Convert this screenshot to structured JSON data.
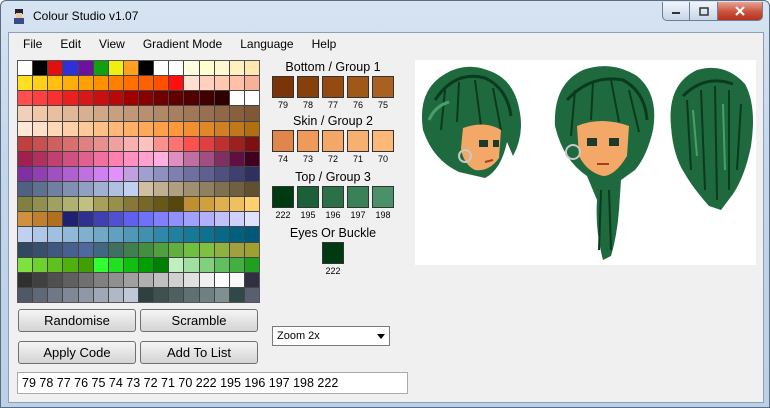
{
  "window": {
    "title": "Colour Studio v1.07"
  },
  "menu": [
    "File",
    "Edit",
    "View",
    "Gradient Mode",
    "Language",
    "Help"
  ],
  "palette": [
    [
      "#ffffff",
      "#000000",
      "#e01010",
      "#3030d8",
      "#7010a0",
      "#10a010",
      "#f0f010",
      "#ffa020",
      "#000000",
      "#ffffff",
      "#ffffff",
      "#ffffe0",
      "#ffffd0",
      "#fff8d0",
      "#fff0c0",
      "#ffe8b0"
    ],
    [
      "#ffe020",
      "#ffd018",
      "#ffc010",
      "#ffb008",
      "#ffa000",
      "#ff9000",
      "#ff8000",
      "#ff7000",
      "#ff6000",
      "#ff5000",
      "#ff1010",
      "#ffe0d0",
      "#ffd0c0",
      "#ffc8b0",
      "#ffc0a8",
      "#f8b098"
    ],
    [
      "#ff5050",
      "#ff4040",
      "#f83030",
      "#e82020",
      "#d81818",
      "#c81010",
      "#b80808",
      "#a00000",
      "#880000",
      "#700000",
      "#600000",
      "#500000",
      "#400000",
      "#300000",
      "#ffffff",
      "#ffffff"
    ],
    [
      "#f0d0b8",
      "#f0c8a8",
      "#e8c0a0",
      "#e0b898",
      "#d8b090",
      "#d0a888",
      "#c8a080",
      "#c09878",
      "#b89070",
      "#b08868",
      "#a88060",
      "#a07858",
      "#987050",
      "#906848",
      "#886040",
      "#805838"
    ],
    [
      "#ffe8d8",
      "#ffe0c8",
      "#ffd8b8",
      "#ffd0a8",
      "#ffc898",
      "#ffc088",
      "#ffb878",
      "#ffb068",
      "#ffa858",
      "#ffa048",
      "#ff9838",
      "#f09030",
      "#e08828",
      "#d08020",
      "#c07818",
      "#b07010"
    ],
    [
      "#c04040",
      "#c85050",
      "#d06060",
      "#d87070",
      "#e08080",
      "#e89090",
      "#f0a0a0",
      "#f8b0b0",
      "#ffc0c0",
      "#ff9090",
      "#ff7070",
      "#ff5050",
      "#e04040",
      "#c03030",
      "#a02020",
      "#801010"
    ],
    [
      "#a02050",
      "#b03060",
      "#c04070",
      "#d05080",
      "#e06090",
      "#f070a0",
      "#ff80b0",
      "#ff90c0",
      "#ffa0d0",
      "#ffb0e0",
      "#e090c0",
      "#c070a0",
      "#a05080",
      "#803060",
      "#601040",
      "#400020"
    ],
    [
      "#8030a0",
      "#9040b0",
      "#a050c0",
      "#b060d0",
      "#c070e0",
      "#d080f0",
      "#e090ff",
      "#c0a0e0",
      "#a0a0d0",
      "#9090c0",
      "#8080b0",
      "#7070a0",
      "#606090",
      "#505080",
      "#404070",
      "#303060"
    ],
    [
      "#506080",
      "#607090",
      "#7080a0",
      "#8090b0",
      "#90a0c0",
      "#a0b0d0",
      "#b0c0e0",
      "#c0d0f0",
      "#d0c0a0",
      "#c0b090",
      "#b0a080",
      "#a09070",
      "#908060",
      "#807050",
      "#706040",
      "#605030"
    ],
    [
      "#808040",
      "#909050",
      "#a0a060",
      "#b0b070",
      "#c0c080",
      "#a8a058",
      "#989048",
      "#887838",
      "#786828",
      "#685818",
      "#584808",
      "#c09030",
      "#d0a040",
      "#e0b050",
      "#f0c060",
      "#ffd070"
    ],
    [
      "#d09040",
      "#c08030",
      "#b07020",
      "#202070",
      "#303090",
      "#4040b0",
      "#5050d0",
      "#6060f0",
      "#7070ff",
      "#8080ff",
      "#9090ff",
      "#a0a0ff",
      "#b0b0ff",
      "#c0c0ff",
      "#d0d0ff",
      "#e0e0ff"
    ],
    [
      "#c0d0f0",
      "#b0c8e8",
      "#a0c0e0",
      "#90b8d8",
      "#80b0d0",
      "#70a8c8",
      "#60a0c0",
      "#5098b8",
      "#4090b0",
      "#3088a8",
      "#2080a0",
      "#187898",
      "#107090",
      "#086888",
      "#006080",
      "#005878"
    ],
    [
      "#304860",
      "#385070",
      "#405880",
      "#486090",
      "#5068a0",
      "#406880",
      "#407060",
      "#408050",
      "#409040",
      "#50a040",
      "#60b040",
      "#70c040",
      "#80c040",
      "#90b040",
      "#a0a040",
      "#a0a030"
    ],
    [
      "#80e040",
      "#70d030",
      "#60c020",
      "#50b010",
      "#40a000",
      "#30ff30",
      "#20e020",
      "#10c010",
      "#00a000",
      "#008000",
      "#c0f0c0",
      "#a0e0a0",
      "#80d080",
      "#60c060",
      "#40b040",
      "#20a020"
    ],
    [
      "#303030",
      "#404040",
      "#505050",
      "#606060",
      "#707070",
      "#808080",
      "#909090",
      "#a0a0a0",
      "#b0b0b0",
      "#c0c0c0",
      "#d0d0d0",
      "#e0e0e0",
      "#f0f0f0",
      "#ffffff",
      "#f8f8f8",
      "#303040"
    ],
    [
      "#505868",
      "#606878",
      "#707888",
      "#808898",
      "#9098a8",
      "#a0a8b8",
      "#b0b8c8",
      "#c0c8d8",
      "#304040",
      "#405050",
      "#506060",
      "#607070",
      "#708080",
      "#809090",
      "#304848",
      "#586070"
    ]
  ],
  "groups": [
    {
      "title": "Bottom / Group 1",
      "swatches": [
        {
          "num": "79",
          "color": "#7a3408"
        },
        {
          "num": "78",
          "color": "#86400c"
        },
        {
          "num": "77",
          "color": "#944a10"
        },
        {
          "num": "76",
          "color": "#a05818"
        },
        {
          "num": "75",
          "color": "#aa6020"
        }
      ]
    },
    {
      "title": "Skin / Group 2",
      "swatches": [
        {
          "num": "74",
          "color": "#e0864a"
        },
        {
          "num": "73",
          "color": "#f09a5a"
        },
        {
          "num": "72",
          "color": "#f4a868"
        },
        {
          "num": "71",
          "color": "#f8b070"
        },
        {
          "num": "70",
          "color": "#fcb878"
        }
      ]
    },
    {
      "title": "Top / Group 3",
      "swatches": [
        {
          "num": "222",
          "color": "#003a10"
        },
        {
          "num": "195",
          "color": "#1c6038"
        },
        {
          "num": "196",
          "color": "#2a7048"
        },
        {
          "num": "197",
          "color": "#3a8058"
        },
        {
          "num": "198",
          "color": "#4a9068"
        }
      ]
    },
    {
      "title": "Eyes Or Buckle",
      "swatches": [
        {
          "num": "222",
          "color": "#003a10"
        }
      ]
    }
  ],
  "buttons": {
    "randomise": "Randomise",
    "scramble": "Scramble",
    "apply": "Apply Code",
    "add": "Add To List"
  },
  "zoom": {
    "value": "Zoom 2x"
  },
  "code": "79 78 77 76 75 74 73 72 71 70 222 195 196 197 198 222"
}
